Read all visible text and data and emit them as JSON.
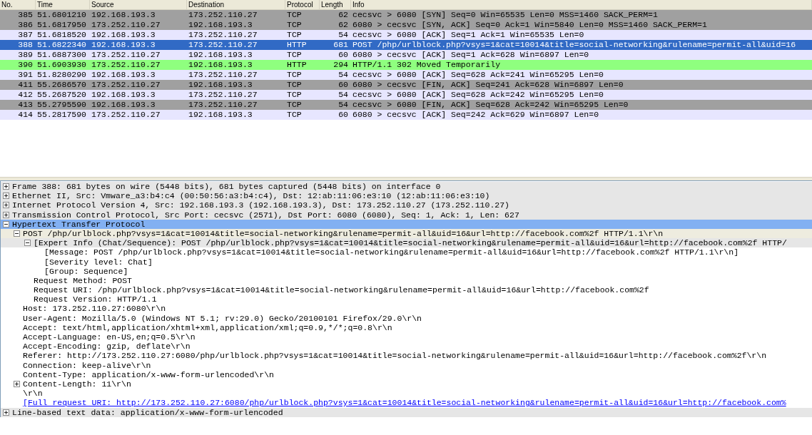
{
  "packet_list": {
    "columns": [
      "No.",
      "Time",
      "Source",
      "Destination",
      "Protocol",
      "Length",
      "Info"
    ],
    "rows": [
      {
        "no": "385",
        "time": "51.6801210",
        "source": "192.168.193.3",
        "destination": "173.252.110.27",
        "protocol": "TCP",
        "length": "62",
        "info": "cecsvc > 6080 [SYN] Seq=0 Win=65535 Len=0 MSS=1460 SACK_PERM=1",
        "selected": false,
        "color": "#a0a0a0"
      },
      {
        "no": "386",
        "time": "51.6817950",
        "source": "173.252.110.27",
        "destination": "192.168.193.3",
        "protocol": "TCP",
        "length": "62",
        "info": "6080 > cecsvc [SYN, ACK] Seq=0 Ack=1 Win=5840 Len=0 MSS=1460 SACK_PERM=1",
        "selected": false,
        "color": "#a0a0a0"
      },
      {
        "no": "387",
        "time": "51.6818520",
        "source": "192.168.193.3",
        "destination": "173.252.110.27",
        "protocol": "TCP",
        "length": "54",
        "info": "cecsvc > 6080 [ACK] Seq=1 Ack=1 Win=65535 Len=0",
        "selected": false,
        "color": "#e7e6ff"
      },
      {
        "no": "388",
        "time": "51.6822340",
        "source": "192.168.193.3",
        "destination": "173.252.110.27",
        "protocol": "HTTP",
        "length": "681",
        "info": "POST /php/urlblock.php?vsys=1&cat=10014&title=social-networking&rulename=permit-all&uid=16",
        "selected": true
      },
      {
        "no": "389",
        "time": "51.6887300",
        "source": "173.252.110.27",
        "destination": "192.168.193.3",
        "protocol": "TCP",
        "length": "60",
        "info": "6080 > cecsvc [ACK] Seq=1 Ack=628 Win=6897 Len=0",
        "selected": false,
        "color": "#e7e6ff"
      },
      {
        "no": "390",
        "time": "51.6903930",
        "source": "173.252.110.27",
        "destination": "192.168.193.3",
        "protocol": "HTTP",
        "length": "294",
        "info": "HTTP/1.1 302 Moved Temporarily",
        "selected": false,
        "color": "#8fff7f"
      },
      {
        "no": "391",
        "time": "51.8280290",
        "source": "192.168.193.3",
        "destination": "173.252.110.27",
        "protocol": "TCP",
        "length": "54",
        "info": "cecsvc > 6080 [ACK] Seq=628 Ack=241 Win=65295 Len=0",
        "selected": false,
        "color": "#e7e6ff"
      },
      {
        "no": "411",
        "time": "55.2686570",
        "source": "173.252.110.27",
        "destination": "192.168.193.3",
        "protocol": "TCP",
        "length": "60",
        "info": "6080 > cecsvc [FIN, ACK] Seq=241 Ack=628 Win=6897 Len=0",
        "selected": false,
        "color": "#a0a0a0"
      },
      {
        "no": "412",
        "time": "55.2687520",
        "source": "192.168.193.3",
        "destination": "173.252.110.27",
        "protocol": "TCP",
        "length": "54",
        "info": "cecsvc > 6080 [ACK] Seq=628 Ack=242 Win=65295 Len=0",
        "selected": false,
        "color": "#e7e6ff"
      },
      {
        "no": "413",
        "time": "55.2795590",
        "source": "192.168.193.3",
        "destination": "173.252.110.27",
        "protocol": "TCP",
        "length": "54",
        "info": "cecsvc > 6080 [FIN, ACK] Seq=628 Ack=242 Win=65295 Len=0",
        "selected": false,
        "color": "#a0a0a0"
      },
      {
        "no": "414",
        "time": "55.2817590",
        "source": "173.252.110.27",
        "destination": "192.168.193.3",
        "protocol": "TCP",
        "length": "60",
        "info": "6080 > cecsvc [ACK] Seq=242 Ack=629 Win=6897 Len=0",
        "selected": false,
        "color": "#e7e6ff"
      }
    ]
  },
  "packet_details": {
    "items": [
      {
        "kind": "field",
        "text": "Frame 388: 681 bytes on wire (5448 bits), 681 bytes captured (5448 bits) on interface 0",
        "expanded": false,
        "selected": false,
        "color": "#e6e6e6"
      },
      {
        "kind": "field",
        "text": "Ethernet II, Src: Vmware_a3:b4:c4 (00:50:56:a3:b4:c4), Dst: 12:ab:11:06:e3:10 (12:ab:11:06:e3:10)",
        "expanded": false,
        "selected": false,
        "color": "#e6e6e6"
      },
      {
        "kind": "field",
        "text": "Internet Protocol Version 4, Src: 192.168.193.3 (192.168.193.3), Dst: 173.252.110.27 (173.252.110.27)",
        "expanded": false,
        "selected": false,
        "color": "#e6e6e6"
      },
      {
        "kind": "field",
        "text": "Transmission Control Protocol, Src Port: cecsvc (2571), Dst Port: 6080 (6080), Seq: 1, Ack: 1, Len: 627",
        "expanded": false,
        "selected": false,
        "color": "#e6e6e6"
      },
      {
        "kind": "field",
        "text": "Hypertext Transfer Protocol",
        "expanded": true,
        "selected": true,
        "children": [
          {
            "kind": "field",
            "text": "POST /php/urlblock.php?vsys=1&cat=10014&title=social-networking&rulename=permit-all&uid=16&url=http://facebook.com%2f HTTP/1.1\\r\\n",
            "expanded": true,
            "selected": false,
            "color": "#eeecdf",
            "children": [
              {
                "kind": "field",
                "text": "[Expert Info (Chat/Sequence): POST /php/urlblock.php?vsys=1&cat=10014&title=social-networking&rulename=permit-all&uid=16&url=http://facebook.com%2f HTTP/",
                "expanded": true,
                "selected": false,
                "color": "#e6e6e6",
                "children": [
                  {
                    "kind": "field",
                    "text": "[Message: POST /php/urlblock.php?vsys=1&cat=10014&title=social-networking&rulename=permit-all&uid=16&url=http://facebook.com%2f HTTP/1.1\\r\\n]",
                    "selected": false
                  },
                  {
                    "kind": "field",
                    "text": "[Severity level: Chat]",
                    "selected": false
                  },
                  {
                    "kind": "field",
                    "text": "[Group: Sequence]",
                    "selected": false
                  }
                ]
              },
              {
                "kind": "field",
                "text": "Request Method: POST",
                "selected": false
              },
              {
                "kind": "field",
                "text": "Request URI: /php/urlblock.php?vsys=1&cat=10014&title=social-networking&rulename=permit-all&uid=16&url=http://facebook.com%2f",
                "selected": false
              },
              {
                "kind": "field",
                "text": "Request Version: HTTP/1.1",
                "selected": false
              }
            ]
          },
          {
            "kind": "field",
            "text": "Host: 173.252.110.27:6080\\r\\n",
            "selected": false
          },
          {
            "kind": "field",
            "text": "User-Agent: Mozilla/5.0 (Windows NT 5.1; rv:29.0) Gecko/20100101 Firefox/29.0\\r\\n",
            "selected": false
          },
          {
            "kind": "field",
            "text": "Accept: text/html,application/xhtml+xml,application/xml;q=0.9,*/*;q=0.8\\r\\n",
            "selected": false
          },
          {
            "kind": "field",
            "text": "Accept-Language: en-US,en;q=0.5\\r\\n",
            "selected": false
          },
          {
            "kind": "field",
            "text": "Accept-Encoding: gzip, deflate\\r\\n",
            "selected": false
          },
          {
            "kind": "field",
            "text": "Referer: http://173.252.110.27:6080/php/urlblock.php?vsys=1&cat=10014&title=social-networking&rulename=permit-all&uid=16&url=http://facebook.com%2f\\r\\n",
            "selected": false
          },
          {
            "kind": "field",
            "text": "Connection: keep-alive\\r\\n",
            "selected": false
          },
          {
            "kind": "field",
            "text": "Content-Type: application/x-www-form-urlencoded\\r\\n",
            "selected": false
          },
          {
            "kind": "field",
            "text": "Content-Length: 11\\r\\n",
            "expanded": false,
            "selected": false
          },
          {
            "kind": "field",
            "text": "\\r\\n",
            "selected": false
          },
          {
            "kind": "link",
            "text": "[Full request URI: http://173.252.110.27:6080/php/urlblock.php?vsys=1&cat=10014&title=social-networking&rulename=permit-all&uid=16&url=http://facebook.com%",
            "selected": false
          }
        ]
      },
      {
        "kind": "field",
        "text": "Line-based text data: application/x-www-form-urlencoded",
        "expanded": false,
        "selected": false,
        "color": "#e6e6e6"
      }
    ]
  }
}
